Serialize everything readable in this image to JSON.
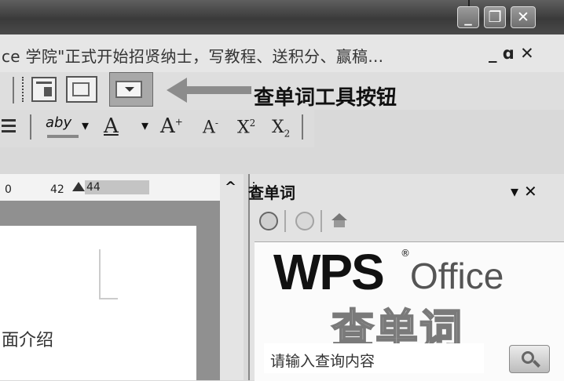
{
  "title_bar": {
    "buttons": {
      "minimize": "_",
      "restore": "❐",
      "close": "✕"
    }
  },
  "document_bar": {
    "title": "ce 学院\"正式开始招贤纳士，写教程、送积分、赢稿...",
    "controls": "_ ɑ ✕"
  },
  "toolbar": {
    "annotation": "查单词工具按钮",
    "format": {
      "highlight": "aby",
      "font_color": "A",
      "grow": "A",
      "grow_sup": "+",
      "shrink": "A",
      "shrink_sup": "-",
      "superscript": "X",
      "superscript_sup": "2",
      "subscript": "X",
      "subscript_sub": "2",
      "dropdown": "▾"
    }
  },
  "ruler": {
    "mark_1": "0",
    "mark_2": "42",
    "mark_3": "44"
  },
  "scroll": {
    "up": "^"
  },
  "document": {
    "text": "面介绍"
  },
  "task_pane": {
    "title": "查单词",
    "controls": "▾ ✕",
    "brand_wps": "WPS",
    "brand_office": "Office",
    "product": "查单词",
    "search_placeholder": "请输入查询内容"
  }
}
